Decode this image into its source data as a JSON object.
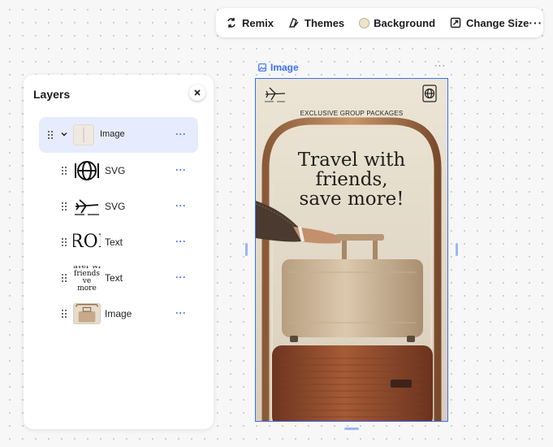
{
  "toolbar": {
    "remix_label": "Remix",
    "themes_label": "Themes",
    "background_label": "Background",
    "change_size_label": "Change Size",
    "more_label": "···",
    "background_swatch_color": "#ece3c9"
  },
  "layers_panel": {
    "title": "Layers",
    "items": [
      {
        "label": "Image",
        "type": "image",
        "selected": true,
        "expanded": true
      },
      {
        "label": "SVG",
        "type": "svg-globe"
      },
      {
        "label": "SVG",
        "type": "svg-plane"
      },
      {
        "label": "Text",
        "type": "text",
        "thumb_text": "ROL"
      },
      {
        "label": "Text",
        "type": "text",
        "thumb_text": "aver wi friends ve more"
      },
      {
        "label": "Image",
        "type": "image-suitcase"
      }
    ],
    "item_more_label": "···"
  },
  "canvas": {
    "selection_label": "Image",
    "more_label": "···",
    "caption": "EXCLUSIVE GROUP PACKAGES",
    "headline_line1": "Travel with",
    "headline_line2": "friends,",
    "headline_line3": "save more!"
  },
  "colors": {
    "accent": "#3b6ff5",
    "selected_row": "#e6ecfd",
    "poster_bg": "#e9e1d2",
    "suitcase_top": "#cbb597",
    "suitcase_bottom": "#8a4a2b"
  }
}
